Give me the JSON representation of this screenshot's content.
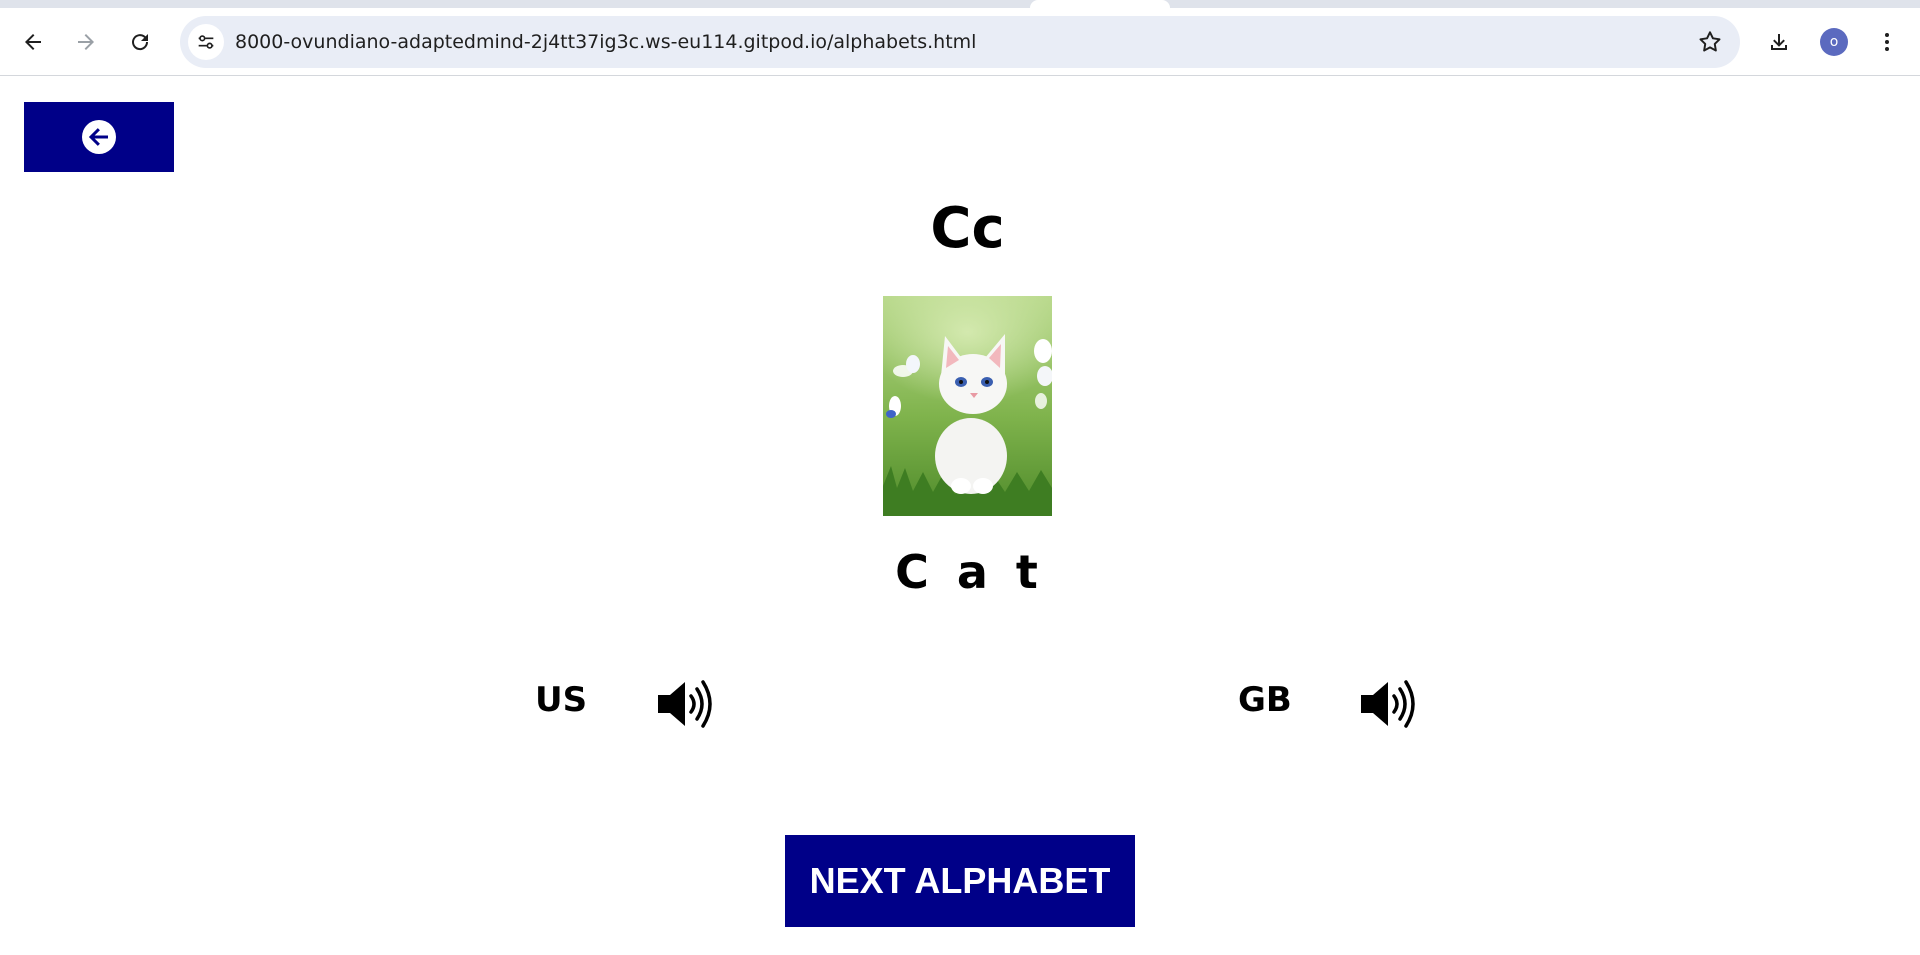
{
  "browser": {
    "url": "8000-ovundiano-adaptedmind-2j4tt37ig3c.ws-eu114.gitpod.io/alphabets.html",
    "profile_initial": "o",
    "avatar_color": "#5b6abf",
    "icons": {
      "back": "arrow-left-icon",
      "forward": "arrow-right-icon",
      "reload": "reload-icon",
      "site_info": "tune-icon",
      "bookmark": "star-icon",
      "downloads": "download-icon",
      "menu": "kebab-menu-icon"
    }
  },
  "page": {
    "accent_color": "#000088",
    "back_icon": "circle-arrow-left-icon",
    "letter": "Cc",
    "picture_subject": "white kitten in grass",
    "word": "C a t",
    "pronunciations": [
      {
        "label": "US",
        "icon": "speaker-icon"
      },
      {
        "label": "GB",
        "icon": "speaker-icon"
      }
    ],
    "next_label": "NEXT ALPHABET"
  }
}
